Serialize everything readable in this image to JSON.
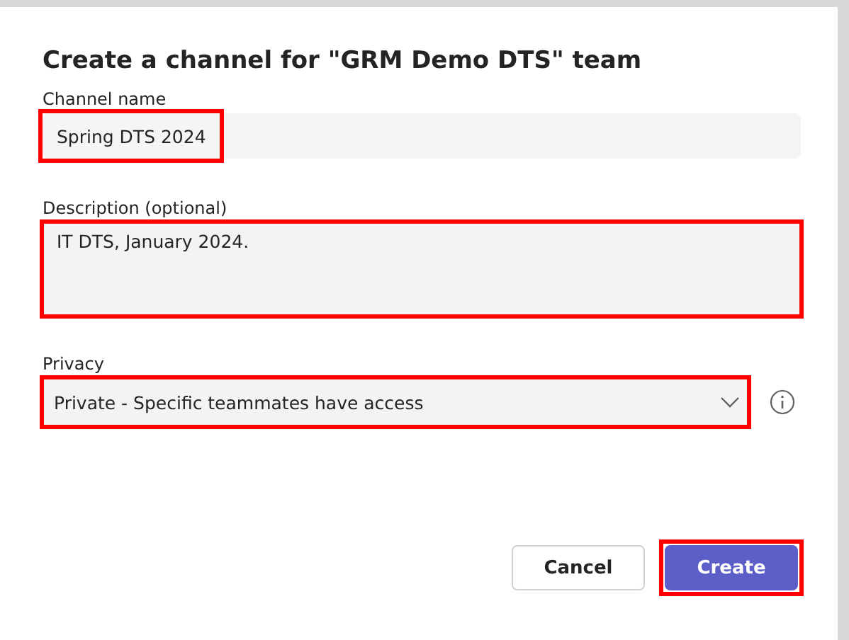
{
  "dialog": {
    "title": "Create a channel for \"GRM Demo DTS\" team"
  },
  "fields": [
    {
      "kind": "text",
      "label": "Channel name",
      "value": "Spring DTS 2024",
      "highlighted": true
    },
    {
      "kind": "textarea",
      "label": "Description (optional)",
      "value": "IT DTS, January 2024.",
      "highlighted": true
    },
    {
      "kind": "select",
      "label": "Privacy",
      "value": "Private - Specific teammates have access",
      "highlighted": true
    }
  ],
  "buttons": [
    {
      "label": "Cancel",
      "kind": "secondary",
      "highlighted": false
    },
    {
      "label": "Create",
      "kind": "primary",
      "highlighted": true
    }
  ]
}
